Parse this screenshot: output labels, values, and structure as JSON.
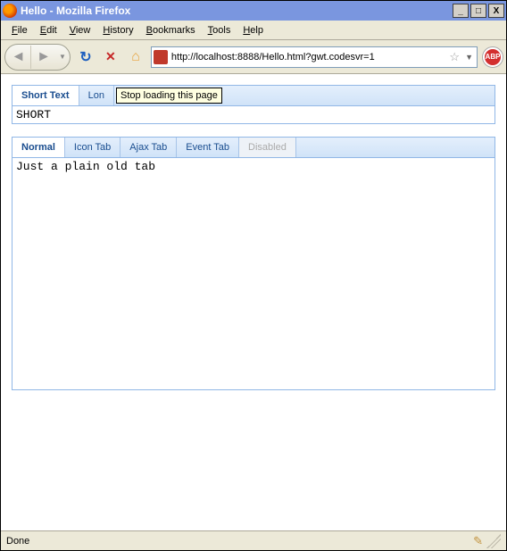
{
  "window": {
    "title": "Hello - Mozilla Firefox",
    "buttons": {
      "min": "_",
      "max": "□",
      "close": "X"
    }
  },
  "menu": {
    "file": "File",
    "edit": "Edit",
    "view": "View",
    "history": "History",
    "bookmarks": "Bookmarks",
    "tools": "Tools",
    "help": "Help"
  },
  "toolbar": {
    "url": "http://localhost:8888/Hello.html?gwt.codesvr=1",
    "abp": "ABP"
  },
  "tooltip": "Stop loading this page",
  "tabset1": {
    "tabs": [
      "Short Text",
      "Lon"
    ],
    "active": 0,
    "content": "SHORT"
  },
  "tabset2": {
    "tabs": [
      "Normal",
      "Icon Tab",
      "Ajax Tab",
      "Event Tab",
      "Disabled"
    ],
    "active": 0,
    "disabled_index": 4,
    "content": "Just a plain old tab"
  },
  "status": {
    "text": "Done"
  }
}
